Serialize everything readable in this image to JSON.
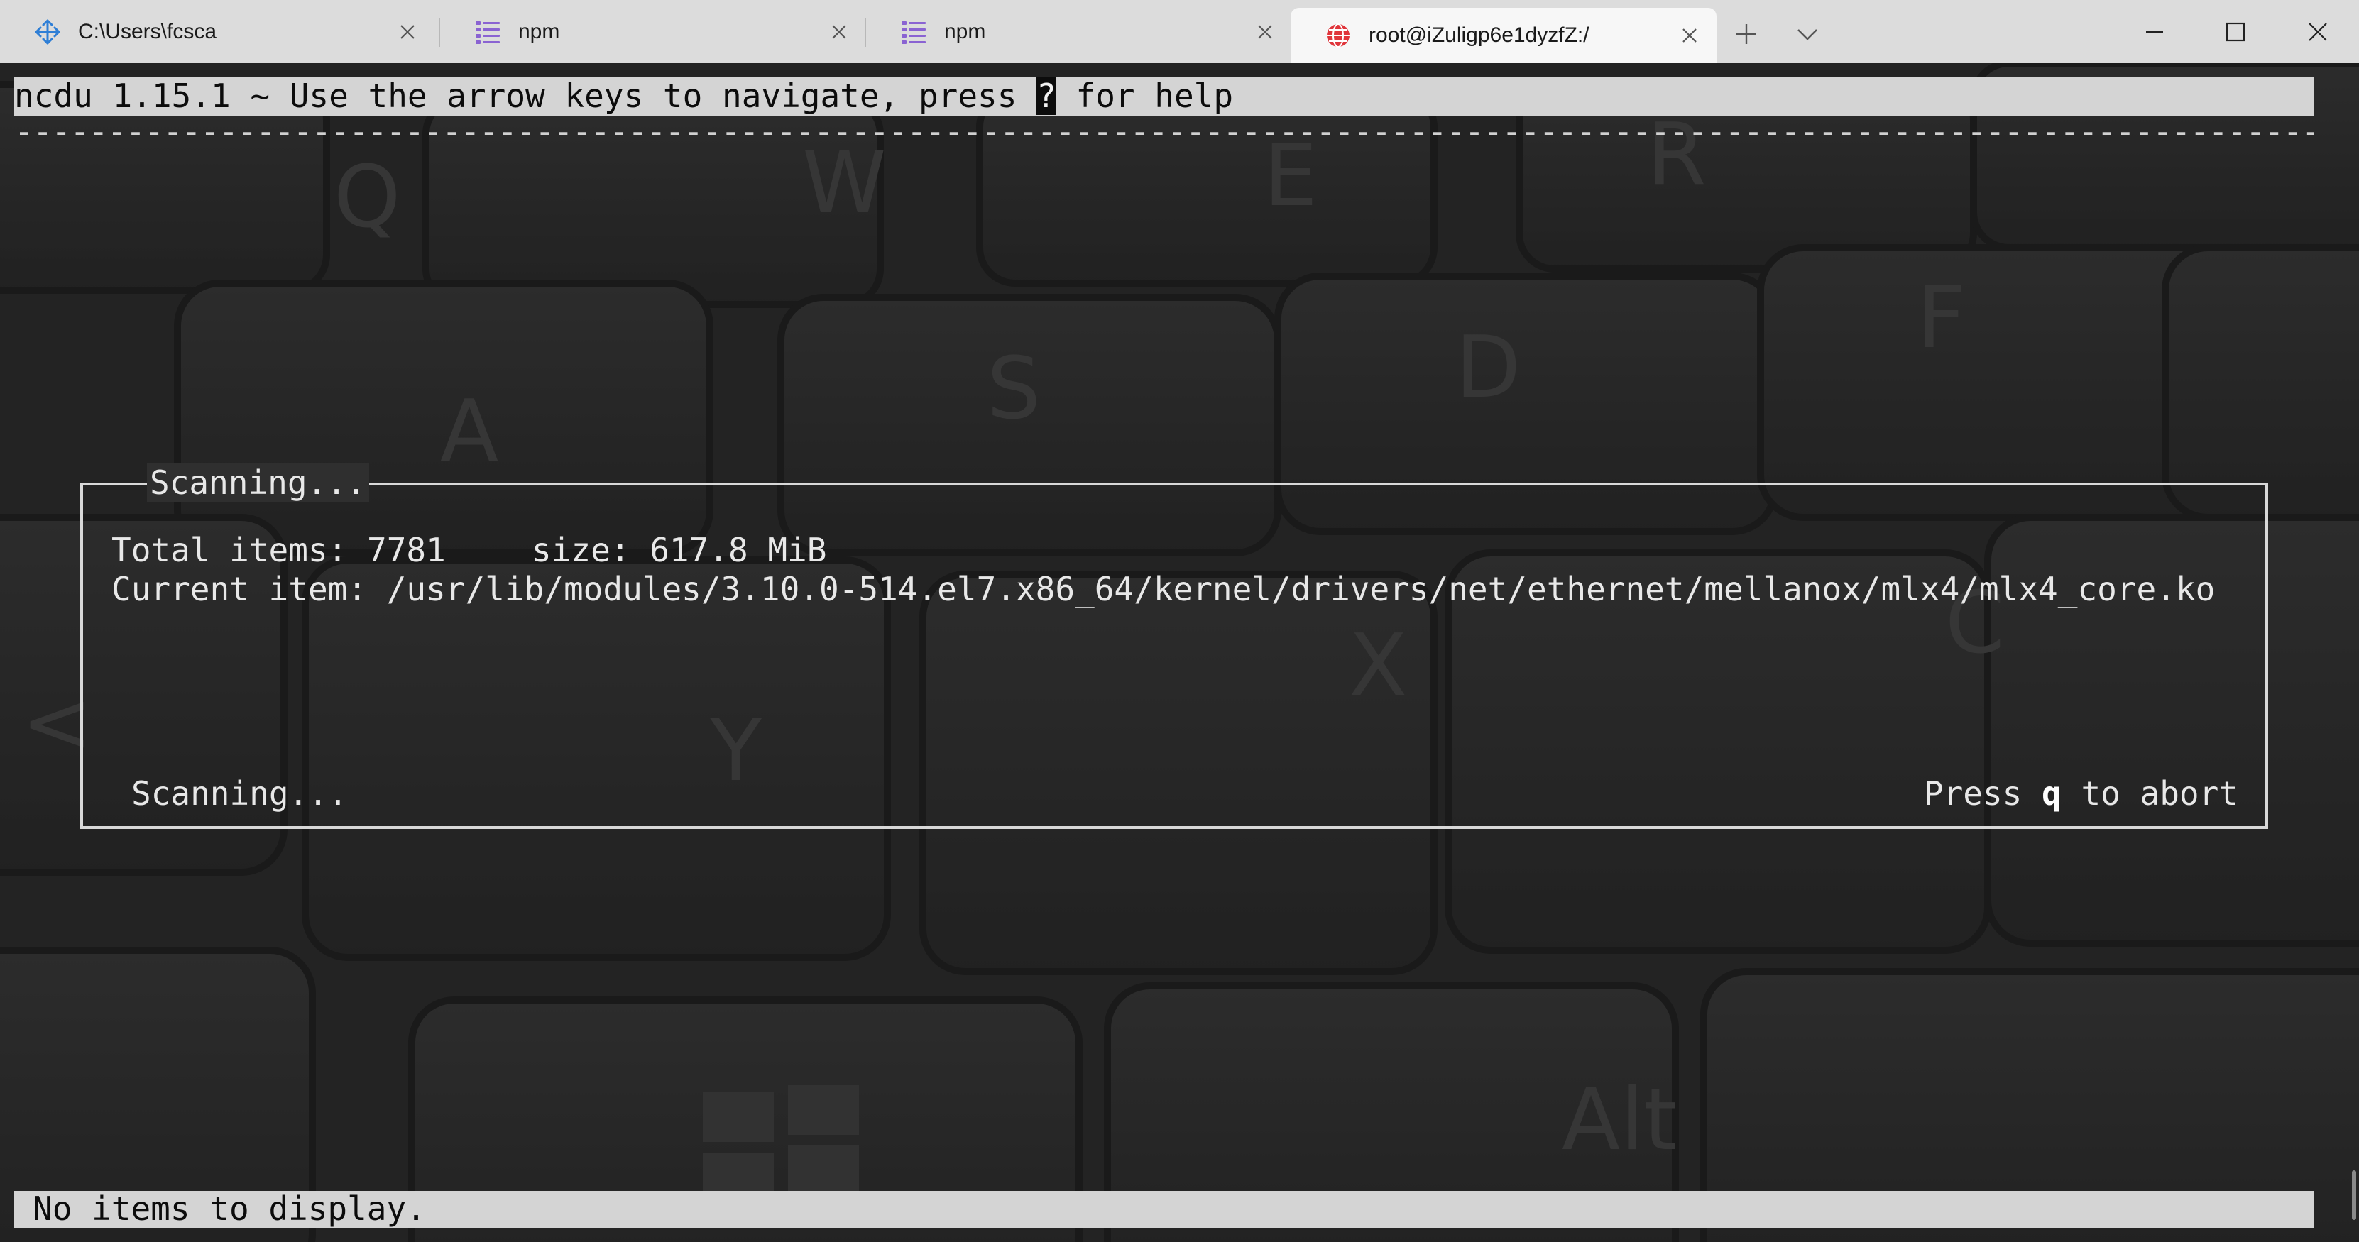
{
  "tabs": [
    {
      "label": "C:\\Users\\fcsca",
      "icon": "move-arrows-icon",
      "active": false
    },
    {
      "label": "npm",
      "icon": "list-icon",
      "active": false
    },
    {
      "label": "npm",
      "icon": "list-icon",
      "active": false
    },
    {
      "label": "root@iZuligp6e1dyzfZ:/",
      "icon": "globe-icon",
      "active": true
    }
  ],
  "window_controls": {
    "new_tab": "+",
    "dropdown": "chevron-down-icon",
    "minimize": "minimize-icon",
    "maximize": "maximize-icon",
    "close": "close-icon"
  },
  "terminal": {
    "header_before": "ncdu 1.15.1 ~ Use the arrow keys to navigate, press ",
    "header_key": "?",
    "header_after": " for help",
    "dialog": {
      "title": "Scanning...",
      "total_items_label": "Total items:",
      "total_items_value": "7781",
      "size_label": "size:",
      "size_value": "617.8 MiB",
      "current_item_label": "Current item:",
      "current_item_value": "/usr/lib/modules/3.10.0-514.el7.x86_64/kernel/drivers/net/ethernet/mellanox/mlx4/mlx4_core.ko",
      "status_text": "Scanning...",
      "abort_prefix": "Press ",
      "abort_key": "q",
      "abort_suffix": " to abort"
    },
    "status_bar": "No items to display."
  },
  "colors": {
    "tabbar_bg": "#dcdcdc",
    "active_tab_bg": "#f7f7f7",
    "terminal_bg": "#2f2f2f",
    "bar_bg": "#d4d4d4",
    "icon_blue": "#2f7fd6",
    "icon_purple": "#8a63d2",
    "icon_red": "#e0353b"
  }
}
